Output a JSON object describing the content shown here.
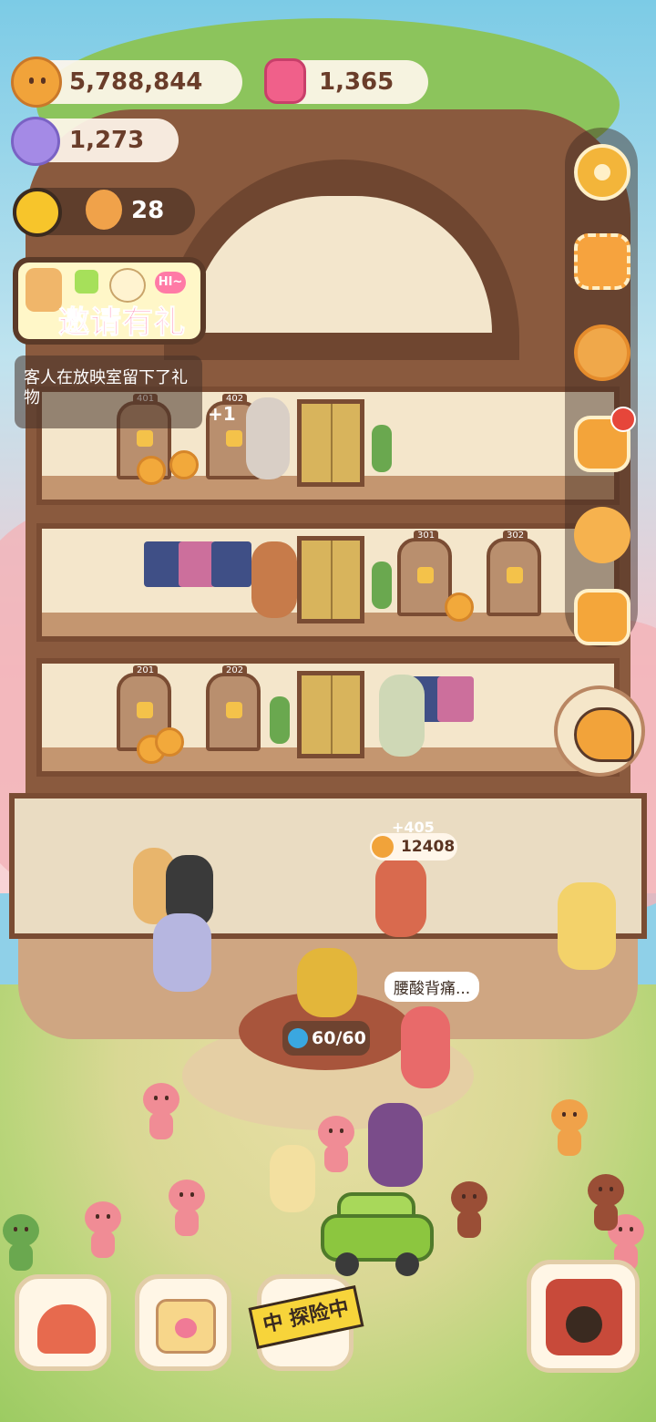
{
  "resources": {
    "cookies": "5,788,844",
    "jelly": "1,365",
    "candy": "1,273",
    "level": "28"
  },
  "icons": {
    "cookie": "cookie-coin-icon",
    "jelly": "jelly-gem-icon",
    "candy": "candy-icon",
    "sun": "sun-level-icon",
    "settings": "gear-icon",
    "stamp": "stamp-icon",
    "medal": "medal-icon",
    "bag": "bag-icon",
    "friends": "friends-icon",
    "camera": "camera-icon",
    "pastry": "pastry-icon",
    "house": "house-icon",
    "calendar": "calendar-heart-icon",
    "theater": "theater-icon"
  },
  "invite": {
    "label": "邀请有礼",
    "hi": "HI~"
  },
  "notification": "客人在放映室留下了礼物",
  "rooms": [
    "401",
    "402",
    "301",
    "302",
    "201",
    "202"
  ],
  "floating": {
    "plus_one": "+1",
    "earn": "+405",
    "coin_total": "12408",
    "speech": "腰酸背痛...",
    "energy": "60/60"
  },
  "bottom": {
    "explore_label": "中 探险中"
  },
  "colors": {
    "hud_text": "#6a3d2a",
    "invite_text": "#ff6fa0",
    "badge_red": "#e6463a",
    "wood": "#7a4c33"
  }
}
